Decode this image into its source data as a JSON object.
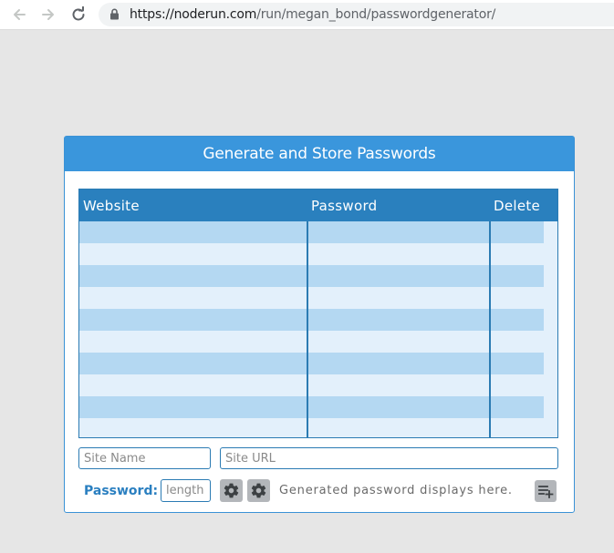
{
  "browser": {
    "url_host": "https://noderun.com",
    "url_path": "/run/megan_bond/passwordgenerator/"
  },
  "app": {
    "title": "Generate and Store Passwords",
    "table": {
      "columns": [
        "Website",
        "Password",
        "Delete"
      ],
      "rows": [
        {
          "website": "",
          "password": "",
          "delete": ""
        },
        {
          "website": "",
          "password": "",
          "delete": ""
        },
        {
          "website": "",
          "password": "",
          "delete": ""
        },
        {
          "website": "",
          "password": "",
          "delete": ""
        },
        {
          "website": "",
          "password": "",
          "delete": ""
        },
        {
          "website": "",
          "password": "",
          "delete": ""
        },
        {
          "website": "",
          "password": "",
          "delete": ""
        },
        {
          "website": "",
          "password": "",
          "delete": ""
        },
        {
          "website": "",
          "password": "",
          "delete": ""
        },
        {
          "website": "",
          "password": "",
          "delete": ""
        }
      ]
    },
    "form": {
      "site_name_placeholder": "Site Name",
      "site_url_placeholder": "Site URL",
      "password_label": "Password:",
      "length_placeholder": "length",
      "generated_text": "Generated password displays here."
    }
  },
  "icons": {
    "back": "arrow-left-icon",
    "forward": "arrow-right-icon",
    "reload": "reload-icon",
    "lock": "lock-icon",
    "gear": "gear-icon",
    "add_list": "playlist-add-icon"
  },
  "colors": {
    "header_blue": "#3a96dc",
    "table_header": "#2a80be",
    "row_odd": "#b4d8f2",
    "row_even": "#e3f0fb",
    "label_blue": "#2a7fc0"
  }
}
